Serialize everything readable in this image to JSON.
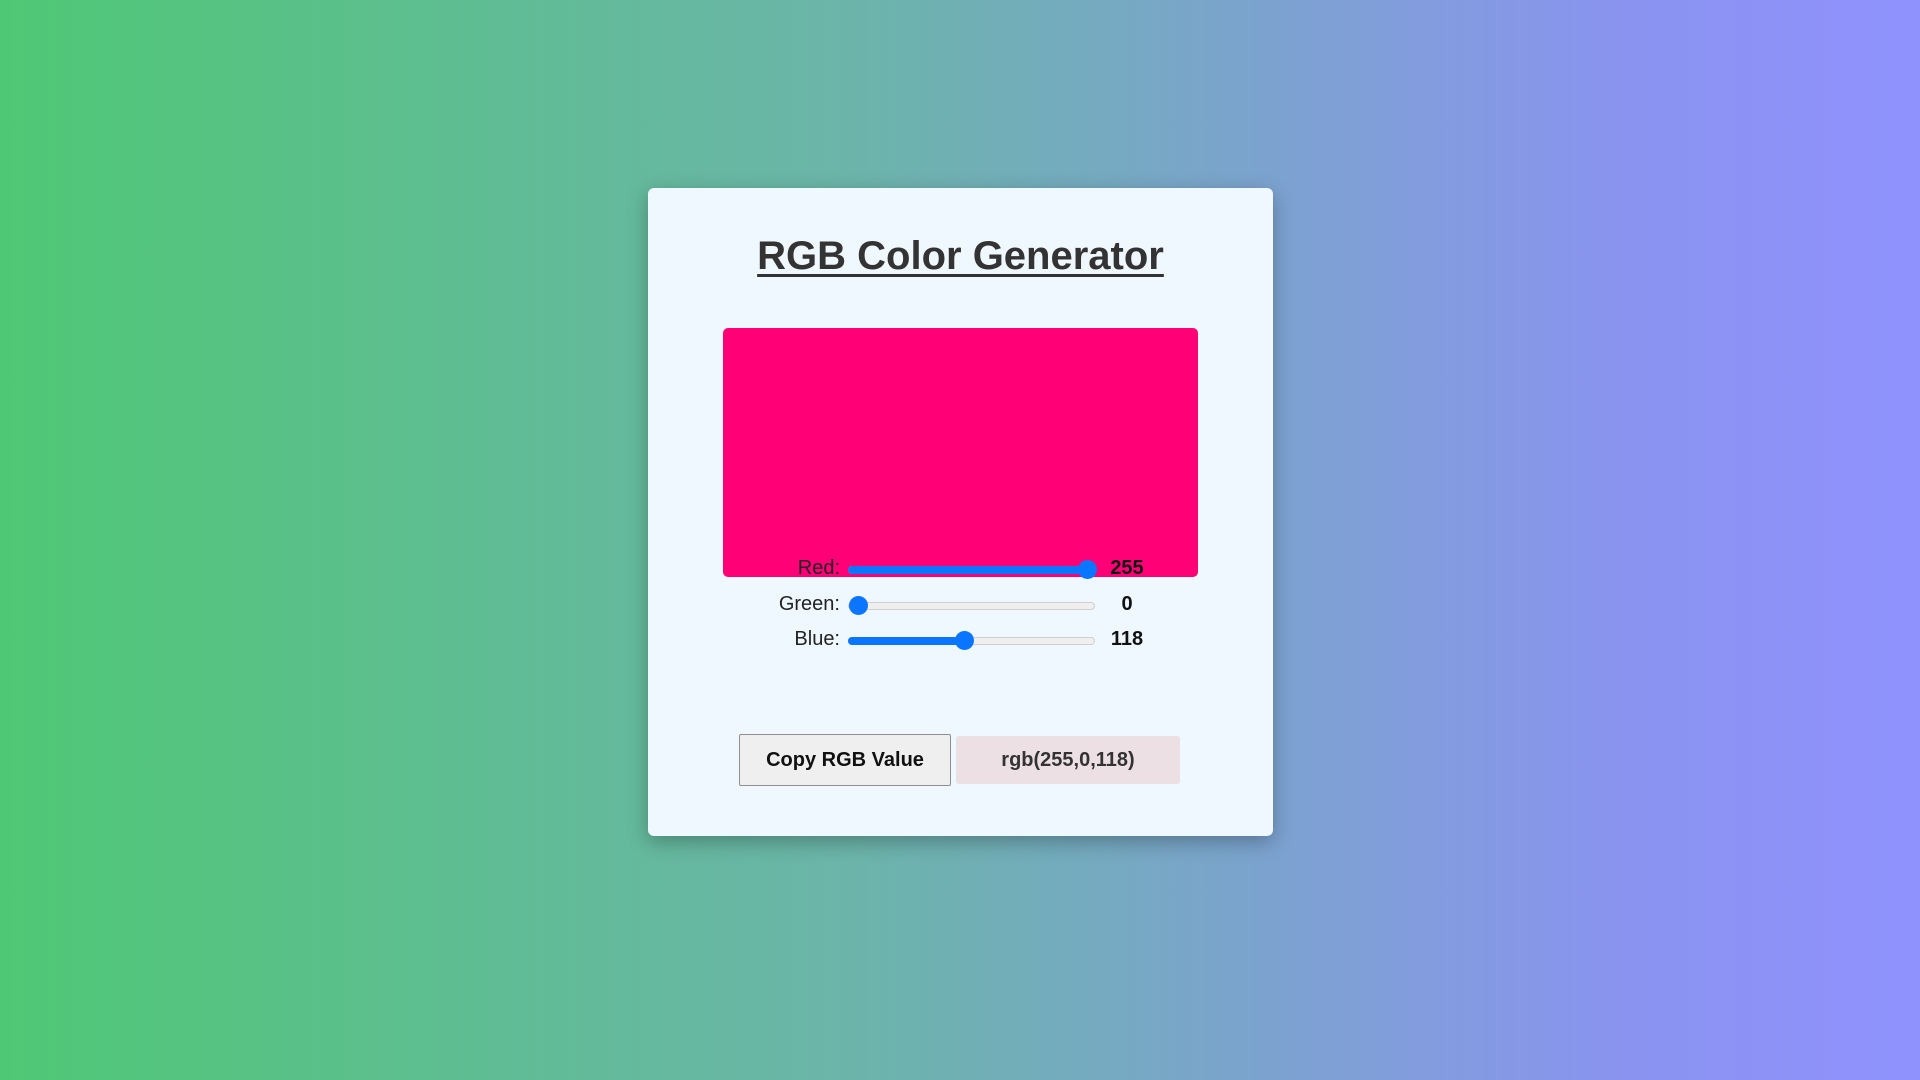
{
  "app": {
    "title": "RGB Color Generator"
  },
  "preview": {
    "color": "#ff0076"
  },
  "sliders": [
    {
      "label": "Red:",
      "value": "255",
      "numeric": 255,
      "max": 255
    },
    {
      "label": "Green:",
      "value": "0",
      "numeric": 0,
      "max": 255
    },
    {
      "label": "Blue:",
      "value": "118",
      "numeric": 118,
      "max": 255
    }
  ],
  "actions": {
    "copy_label": "Copy RGB Value",
    "rgb_text": "rgb(255,0,118)"
  },
  "colors": {
    "accent": "#0a75ff",
    "card_bg": "#f0f8ff",
    "output_bg": "#ede0e4"
  }
}
